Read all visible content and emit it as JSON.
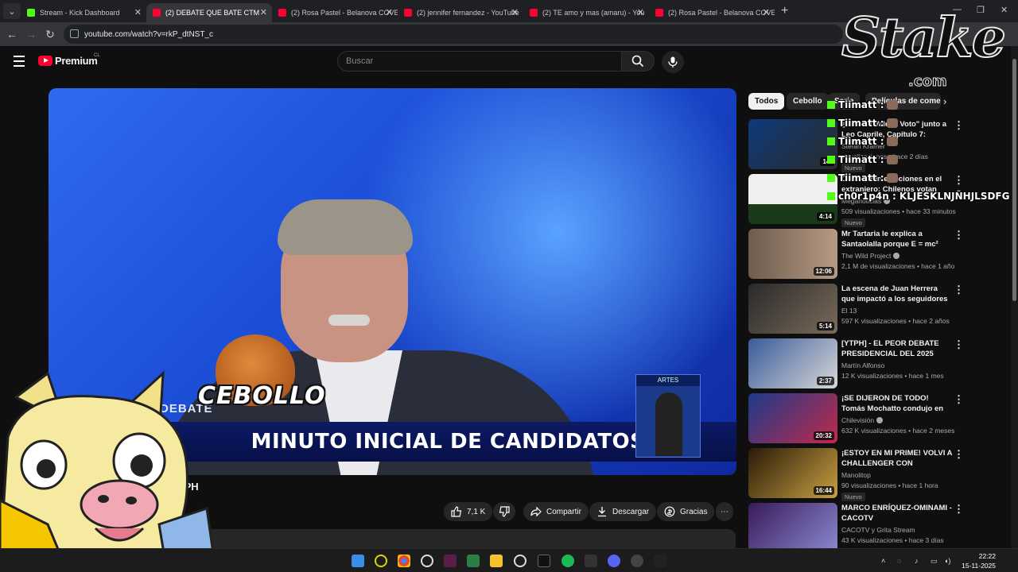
{
  "browser": {
    "tabs": [
      {
        "title": "Stream - Kick Dashboard",
        "favicon": "kick"
      },
      {
        "title": "(2) DEBATE QUE BATE CTM",
        "favicon": "youtube",
        "active": true
      },
      {
        "title": "(2) Rosa Pastel - Belanova COVE",
        "favicon": "youtube"
      },
      {
        "title": "(2) jennifer fernandez - YouTube",
        "favicon": "youtube"
      },
      {
        "title": "(2) TE amo y mas (amaru) - You",
        "favicon": "youtube"
      },
      {
        "title": "(2) Rosa Pastel - Belanova COVE",
        "favicon": "youtube"
      }
    ],
    "url": "youtube.com/watch?v=rkP_dtNST_c"
  },
  "youtube": {
    "logo_text": "Premium",
    "country_code": "CL",
    "search_placeholder": "Buscar",
    "video": {
      "banner_text": "MINUTO INICIAL DE CANDIDATOS",
      "debate_label": "DEBATE",
      "sign_label": "ARTES",
      "overlay_logo": "CEBOLLO",
      "title_visible": "YTPH"
    },
    "actions": {
      "likes": "7,1 K",
      "share": "Compartir",
      "download": "Descargar",
      "thanks": "Gracias",
      "more": "⋯"
    },
    "chips": [
      "Todos",
      "Cebollo",
      "Serie",
      "Películas de come"
    ],
    "recommendations": [
      {
        "title": "¿Cuánto Vale el Voto\" junto a Leo Caprile, Capítulo 7: Eduar...",
        "channel": "Stefan Kramer",
        "meta": "visualizaciones • hace 2 días",
        "duration": "14:",
        "badge": "Nuevo"
      },
      {
        "title": "Comienzan elecciones en el extranjero: Chilenos votan en...",
        "channel": "Meganoticias",
        "meta": "509 visualizaciones • hace 33 minutos",
        "duration": "4:14",
        "badge": "Nuevo",
        "verified": true
      },
      {
        "title": "Mr Tartaria le explica a Santaolalla porque E = mc² est...",
        "channel": "The Wild Project",
        "meta": "2,1 M de visualizaciones • hace 1 año",
        "duration": "12:06",
        "verified": true
      },
      {
        "title": "La escena de Juan Herrera que impactó a los seguidores en lo...",
        "channel": "El 13",
        "meta": "597 K visualizaciones • hace 2 años",
        "duration": "5:14"
      },
      {
        "title": "[YTPH] - EL PEOR DEBATE PRESIDENCIAL DEL 2025",
        "channel": "Martín Alfonso",
        "meta": "12 K visualizaciones • hace 1 mes",
        "duration": "2:37"
      },
      {
        "title": "¡SE DIJERON DE TODO! Tomás Mochatto condujo en DEBATE ...",
        "channel": "Chilevisión",
        "meta": "632 K visualizaciones • hace 2 meses",
        "duration": "20:32",
        "verified": true
      },
      {
        "title": "¡ESTOY EN MI PRIME! VOLVI A CHALLENGER CON RENEKTON",
        "channel": "Manolitop",
        "meta": "90 visualizaciones • hace 1 hora",
        "duration": "16:44",
        "badge": "Nuevo"
      },
      {
        "title": "MARCO ENRÍQUEZ-OMINAMI - CACOTV",
        "channel": "CACOTV y Grita Stream",
        "meta": "43 K visualizaciones • hace 3 días",
        "duration": ""
      }
    ]
  },
  "overlay": {
    "stake_word": "Stake",
    "stake_com": ".com",
    "chat": [
      {
        "user": "Tiimatt",
        "text": ":"
      },
      {
        "user": "Tiimatt",
        "text": ":"
      },
      {
        "user": "Tiimatt",
        "text": ":"
      },
      {
        "user": "Tiimatt",
        "text": ":"
      },
      {
        "user": "Tiimatt",
        "text": ":"
      },
      {
        "user": "ch0r1p4n",
        "text": ": KLJESKLNJÑHJLSDFG"
      }
    ]
  },
  "taskbar": {
    "time": "22:22",
    "date": "15-11-2025"
  },
  "colors": {
    "yt_red": "#ff0033",
    "kick_green": "#53fc18",
    "bg": "#0f0f0f"
  }
}
